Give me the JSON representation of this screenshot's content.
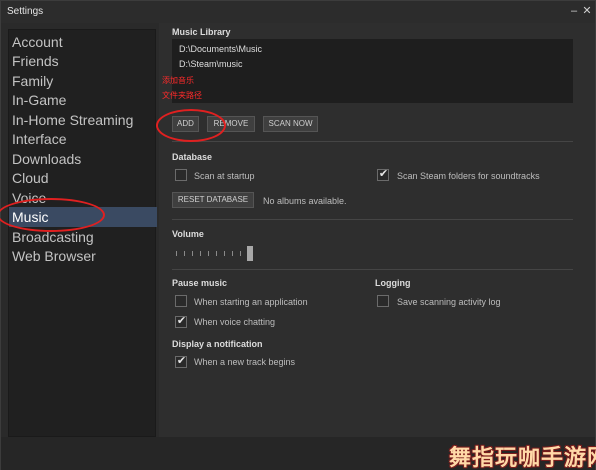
{
  "window": {
    "title": "Settings",
    "minimize_glyph": "–",
    "close_glyph": "✕"
  },
  "sidebar": {
    "items": [
      {
        "label": "Account",
        "active": false
      },
      {
        "label": "Friends",
        "active": false
      },
      {
        "label": "Family",
        "active": false
      },
      {
        "label": "In-Game",
        "active": false
      },
      {
        "label": "In-Home Streaming",
        "active": false
      },
      {
        "label": "Interface",
        "active": false
      },
      {
        "label": "Downloads",
        "active": false
      },
      {
        "label": "Cloud",
        "active": false
      },
      {
        "label": "Voice",
        "active": false
      },
      {
        "label": "Music",
        "active": true
      },
      {
        "label": "Broadcasting",
        "active": false
      },
      {
        "label": "Web Browser",
        "active": false
      }
    ]
  },
  "music_library": {
    "title": "Music Library",
    "paths": [
      "D:\\Documents\\Music",
      "D:\\Steam\\music"
    ],
    "add_label": "ADD",
    "remove_label": "REMOVE",
    "scan_label": "SCAN NOW"
  },
  "annotations": {
    "add_music": "添加音乐",
    "folder_path": "文件夹路径"
  },
  "database": {
    "title": "Database",
    "scan_startup_label": "Scan at startup",
    "scan_startup_checked": false,
    "scan_steam_label": "Scan Steam folders for soundtracks",
    "scan_steam_checked": true,
    "reset_label": "RESET DATABASE",
    "status": "No albums available."
  },
  "volume": {
    "title": "Volume",
    "level": 1.0
  },
  "pause_music": {
    "title": "Pause music",
    "app_label": "When starting an application",
    "app_checked": false,
    "voice_label": "When voice chatting",
    "voice_checked": true
  },
  "logging": {
    "title": "Logging",
    "save_label": "Save scanning activity log",
    "save_checked": false
  },
  "notification": {
    "title": "Display a notification",
    "track_label": "When a new track begins",
    "track_checked": true
  },
  "check_glyph": "✔",
  "watermark": {
    "text": "舞指玩咖手游网"
  },
  "colors": {
    "active_nav": "#3a4a62",
    "annotation_red": "#e02020"
  }
}
